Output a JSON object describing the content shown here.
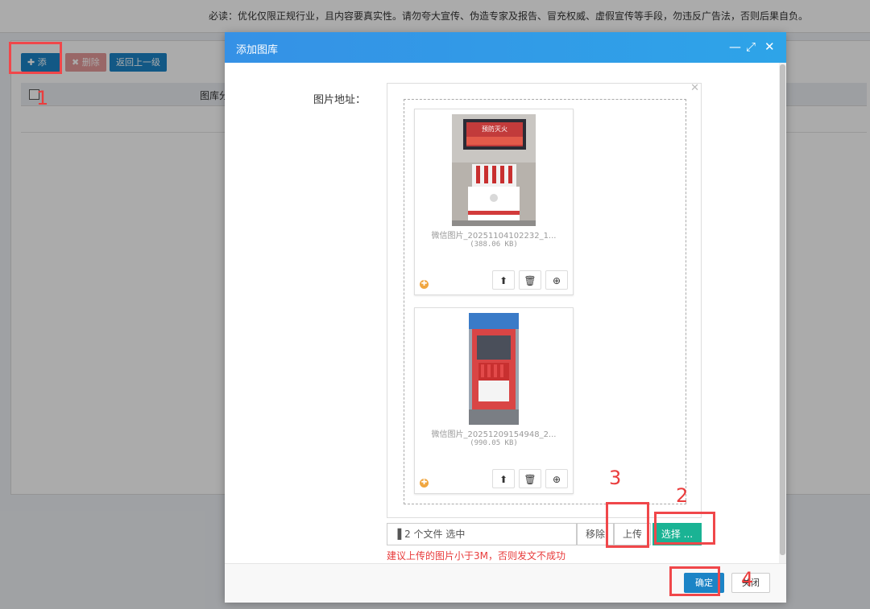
{
  "notice": "必读：优化仅限正规行业，且内容要真实性。请勿夸大宣传、伪造专家及报告、冒充权威、虚假宣传等手段，勿违反广告法，否则后果自负。",
  "toolbar": {
    "add_label": "添加",
    "delete_label": "删除",
    "back_label": "返回上一级"
  },
  "table": {
    "column_partial": "图库分"
  },
  "dialog": {
    "title": "添加图库",
    "field_label": "图片地址：",
    "files": [
      {
        "name": "微信图片_20251104102232_1...",
        "size": "(388.06 KB)",
        "poster_text": "预防灭火"
      },
      {
        "name": "微信图片_20251209154948_2...",
        "size": "(990.05 KB)"
      }
    ],
    "file_caption": "2 个文件 选中",
    "remove_label": "移除",
    "upload_label": "上传",
    "select_label": "选择 ...",
    "hint": "建议上传的图片小于3M，否则发文不成功",
    "ok_label": "确定",
    "close_label": "关闭"
  },
  "steps": [
    "1",
    "2",
    "3",
    "4"
  ],
  "colors": {
    "primary": "#1c84c6",
    "danger": "#e59a9a",
    "success": "#1ab394",
    "callout": "#f0474a",
    "warning": "#f0a640"
  }
}
